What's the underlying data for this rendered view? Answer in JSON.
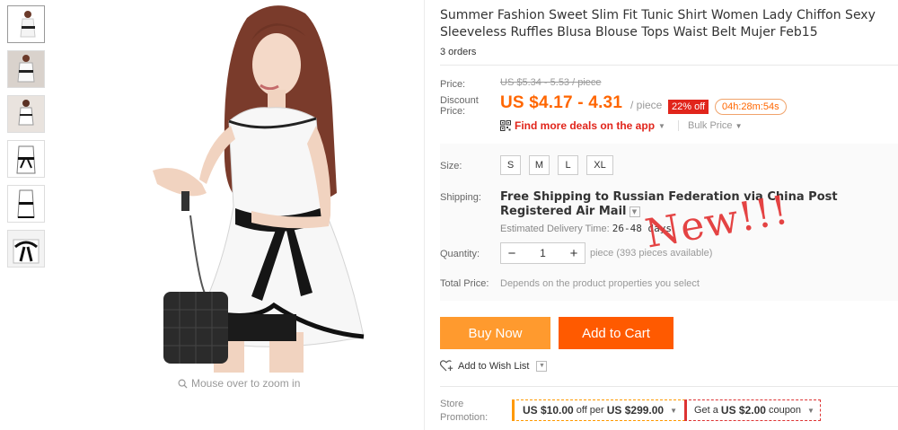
{
  "gallery": {
    "thumbnail_count": 6,
    "zoom_hint": "Mouse over to zoom in"
  },
  "product": {
    "title": "Summer Fashion Sweet Slim Fit Tunic Shirt Women Lady Chiffon Sexy Sleeveless Ruffles Blusa Blouse Tops Waist Belt Mujer Feb15",
    "orders": "3 orders"
  },
  "pricing": {
    "price_label": "Price:",
    "original_price": "US $5.34 - 5.53 / piece",
    "discount_label_line1": "Discount",
    "discount_label_line2": "Price:",
    "discount_price": "US $4.17 - 4.31",
    "per_piece": "/ piece",
    "off_badge": "22% off",
    "countdown": "04h:28m:54s",
    "app_deals": "Find more deals on the app",
    "bulk_price": "Bulk Price"
  },
  "options": {
    "size_label": "Size:",
    "sizes": [
      "S",
      "M",
      "L",
      "XL"
    ],
    "shipping_label": "Shipping:",
    "shipping_text": "Free Shipping to Russian Federation via China Post Registered Air Mail",
    "delivery_label": "Estimated Delivery Time:",
    "delivery_value": "26-48 days",
    "stamp": "New!!!",
    "quantity_label": "Quantity:",
    "quantity_value": "1",
    "quantity_minus": "−",
    "quantity_plus": "+",
    "quantity_note": "piece (393 pieces available)",
    "total_label": "Total Price:",
    "total_note": "Depends on the product properties you select"
  },
  "actions": {
    "buy_now": "Buy Now",
    "add_to_cart": "Add to Cart",
    "wish_list": "Add to Wish List"
  },
  "promotion": {
    "label_line1": "Store",
    "label_line2": "Promotion:",
    "coupon1_prefix": "US $10.00",
    "coupon1_mid": "off per",
    "coupon1_threshold": "US $299.00",
    "coupon2_prefix": "Get a",
    "coupon2_amount": "US $2.00",
    "coupon2_suffix": "coupon"
  },
  "colors": {
    "price_orange": "#ff6600",
    "buy_now": "#ff9a2e",
    "add_to_cart": "#ff5a00",
    "badge_red": "#e1251b"
  }
}
